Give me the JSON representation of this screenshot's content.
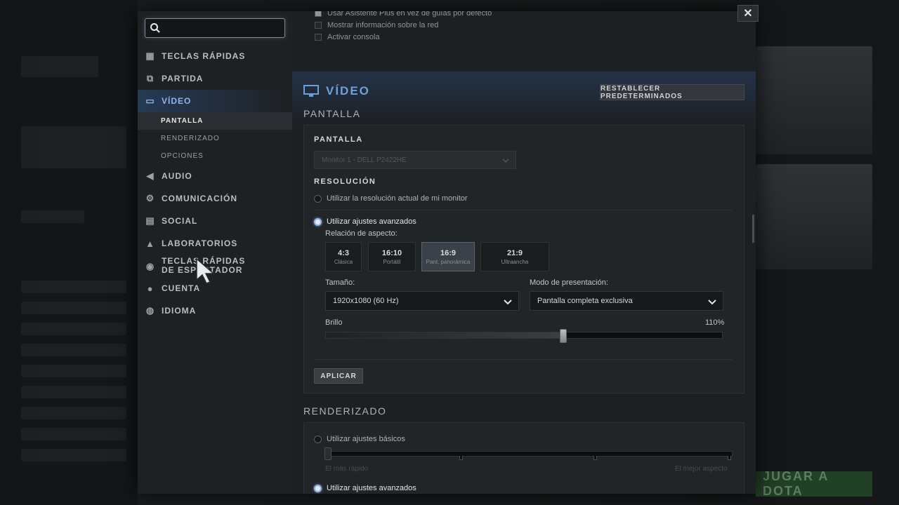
{
  "background": {
    "play_button": "JUGAR A DOTA"
  },
  "search": {
    "placeholder": "",
    "value": ""
  },
  "sidebar": {
    "items": [
      {
        "label": "TECLAS RÁPIDAS",
        "icon": "hotkeys-icon"
      },
      {
        "label": "PARTIDA",
        "icon": "match-icon"
      },
      {
        "label": "VÍDEO",
        "icon": "monitor-icon",
        "active": true
      },
      {
        "label": "AUDIO",
        "icon": "speaker-icon"
      },
      {
        "label": "COMUNICACIÓN",
        "icon": "gear-icon"
      },
      {
        "label": "SOCIAL",
        "icon": "chat-icon"
      },
      {
        "label": "LABORATORIOS",
        "icon": "flask-icon"
      },
      {
        "label": "TECLAS RÁPIDAS DE ESPECTADOR",
        "icon": "spectator-icon"
      },
      {
        "label": "CUENTA",
        "icon": "user-icon"
      },
      {
        "label": "IDIOMA",
        "icon": "globe-icon"
      }
    ],
    "video_subitems": [
      {
        "label": "PANTALLA",
        "active": true
      },
      {
        "label": "RENDERIZADO"
      },
      {
        "label": "OPCIONES"
      }
    ]
  },
  "top_options": [
    {
      "label": "Usar Asistente Plus en vez de guías por defecto",
      "checked": true
    },
    {
      "label": "Mostrar información sobre la red",
      "checked": false
    },
    {
      "label": "Activar consola",
      "checked": false
    }
  ],
  "video": {
    "title": "VÍDEO",
    "reset_label": "RESTABLECER PREDETERMINADOS",
    "section_title": "PANTALLA",
    "display_label": "PANTALLA",
    "monitor_value": "Monitor 1 - DELL P2422HE",
    "resolution_label": "RESOLUCIÓN",
    "res_option_current": "Utilizar la resolución actual de mi monitor",
    "res_option_advanced": "Utilizar ajustes avanzados",
    "aspect_label": "Relación de aspecto:",
    "aspects": [
      {
        "ratio": "4:3",
        "name": "Clásica"
      },
      {
        "ratio": "16:10",
        "name": "Portátil"
      },
      {
        "ratio": "16:9",
        "name": "Pant. panorámica",
        "selected": true
      },
      {
        "ratio": "21:9",
        "name": "Ultraancha"
      }
    ],
    "size_label": "Tamaño:",
    "size_value": "1920x1080 (60 Hz)",
    "mode_label": "Modo de presentación:",
    "mode_value": "Pantalla completa exclusiva",
    "brightness_label": "Brillo",
    "brightness_value": "110%",
    "brightness_fraction": 0.6,
    "apply_label": "APLICAR"
  },
  "render": {
    "section_title": "RENDERIZADO",
    "basic_label": "Utilizar ajustes básicos",
    "fastest_label": "El más rápido",
    "best_label": "El mejor aspecto",
    "advanced_label": "Utilizar ajustes avanzados"
  },
  "close_label": "✕"
}
